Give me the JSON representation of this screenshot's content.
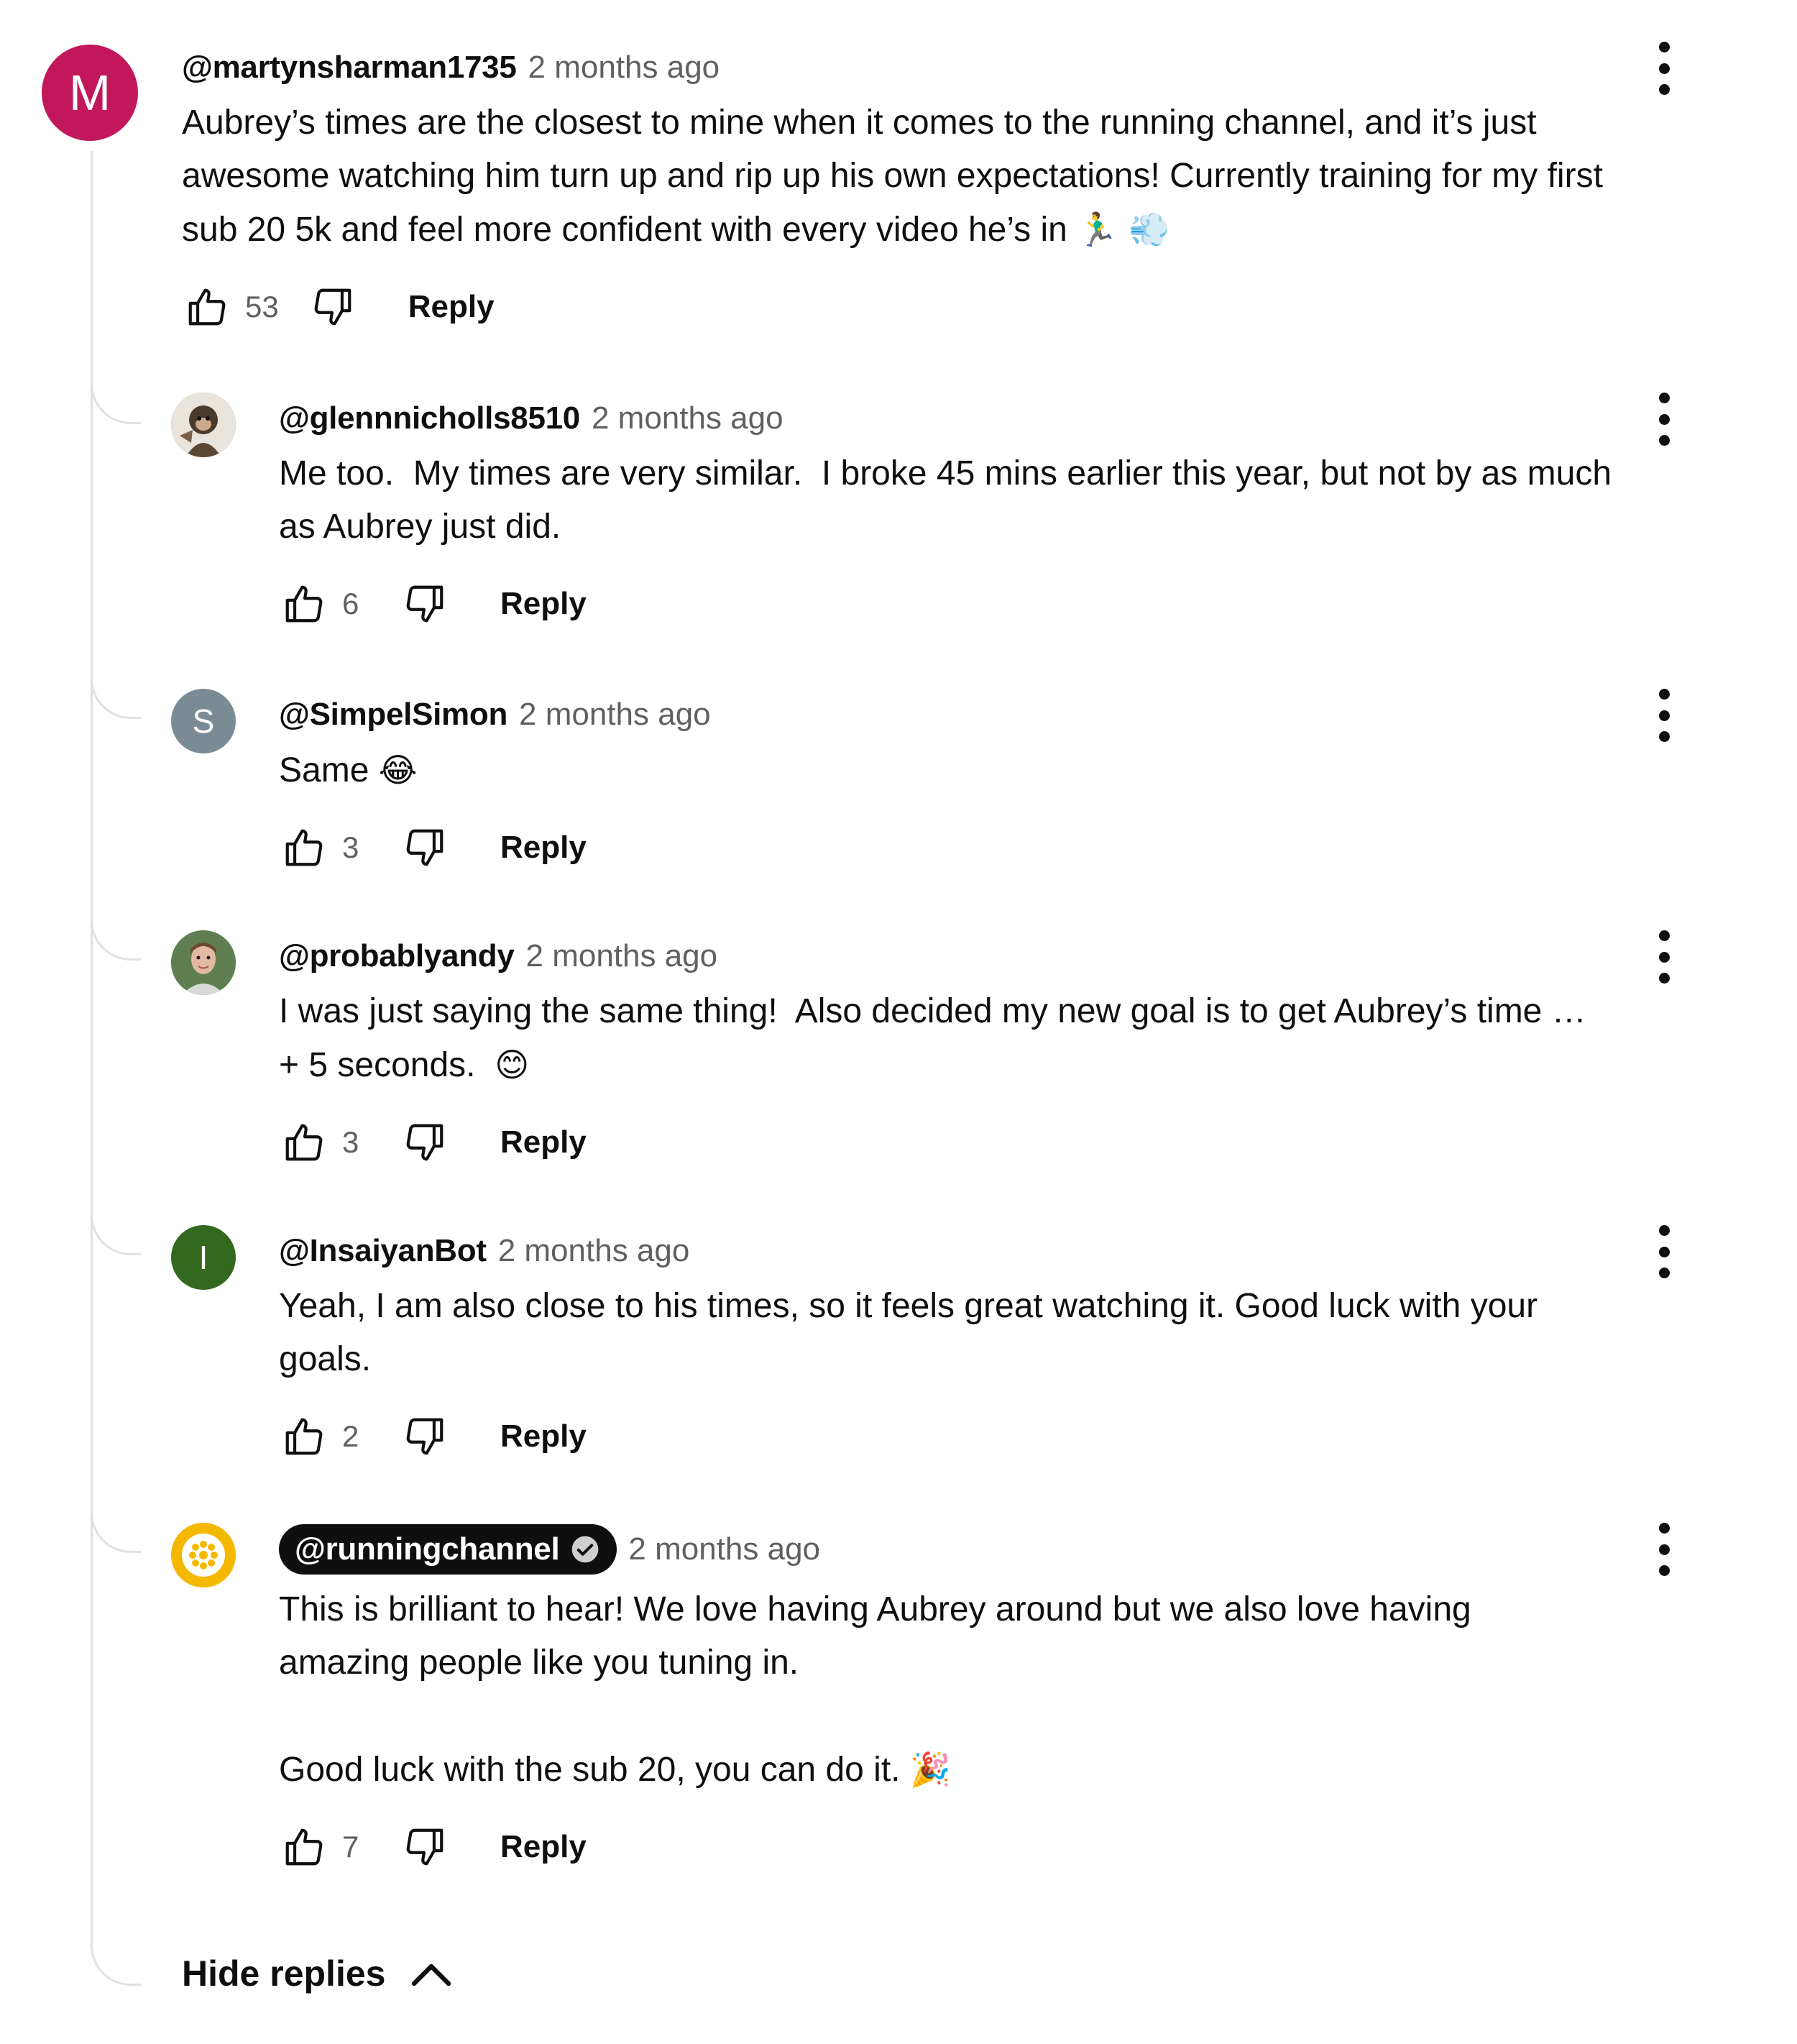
{
  "main_comment": {
    "avatar_letter": "M",
    "avatar_color": "#c2185b",
    "author": "@martynsharman1735",
    "time": "2 months ago",
    "text": "Aubrey’s times are the closest to mine when it comes to the running channel, and it’s just awesome watching him turn up and rip up his own expectations! Currently training for my first sub 20 5k and feel more confident with every video he’s in ",
    "emoji": "🏃‍♂️ 💨",
    "likes": "53",
    "reply_label": "Reply"
  },
  "replies": [
    {
      "avatar_icon": "monkey-photo-avatar",
      "author": "@glennnicholls8510",
      "time": "2 months ago",
      "text": "Me too.  My times are very similar.  I broke 45 mins earlier this year, but not by as much as Aubrey just did.",
      "emoji": "",
      "likes": "6",
      "reply_label": "Reply"
    },
    {
      "avatar_letter": "S",
      "avatar_color": "#7b8b96",
      "author": "@SimpelSimon",
      "time": "2 months ago",
      "text": "Same ",
      "emoji": "😂",
      "likes": "3",
      "reply_label": "Reply"
    },
    {
      "avatar_icon": "person-photo-avatar",
      "author": "@probablyandy",
      "time": "2 months ago",
      "text": "I was just saying the same thing!  Also decided my new goal is to get Aubrey’s time … + 5 seconds.  ",
      "emoji": "😊",
      "likes": "3",
      "reply_label": "Reply"
    },
    {
      "avatar_letter": "I",
      "avatar_color": "#33691e",
      "author": "@InsaiyanBot",
      "time": "2 months ago",
      "text": "Yeah, I am also close to his times, so it feels great watching it. Good luck with your goals.",
      "emoji": "",
      "likes": "2",
      "reply_label": "Reply"
    },
    {
      "avatar_icon": "running-channel-logo",
      "avatar_color": "#f5b800",
      "author": "@runningchannel",
      "verified": true,
      "time": "2 months ago",
      "text": "This is brilliant to hear! We love having Aubrey around but we also love having amazing people like you tuning in.\n\nGood luck with the sub 20, you can do it. ",
      "emoji": "🎉",
      "likes": "7",
      "reply_label": "Reply"
    }
  ],
  "hide_replies_label": "Hide replies"
}
